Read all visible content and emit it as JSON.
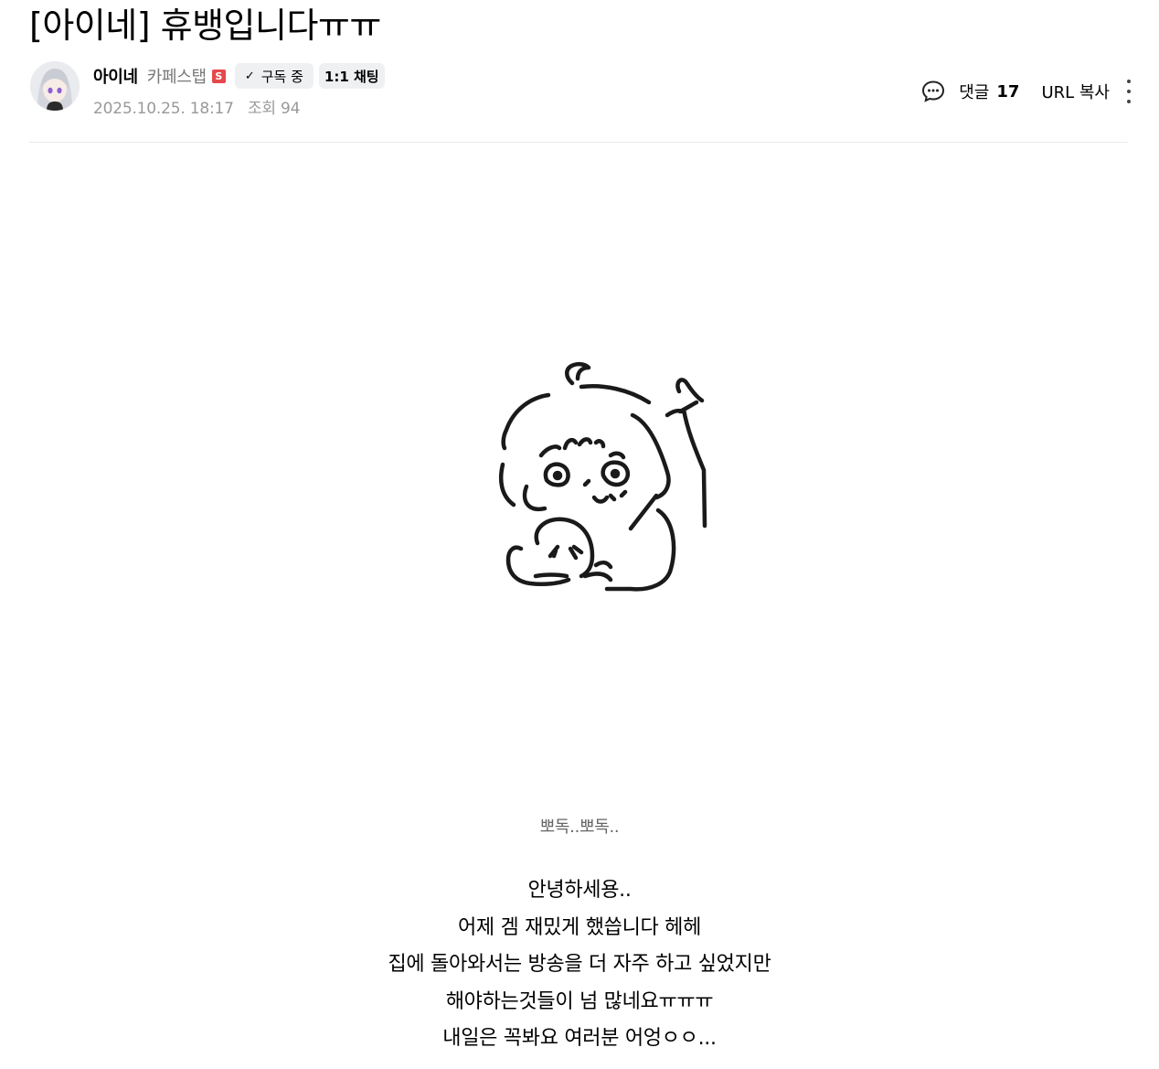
{
  "post": {
    "title": "[아이네] 휴뱅입니다ㅠㅠ"
  },
  "author": {
    "avatar_icon": "avatar-image",
    "name": "아이네",
    "level": "카페스탭",
    "staff_badge": "S",
    "subscribe_label": "구독 중",
    "chat_label": "1:1 채팅"
  },
  "meta": {
    "date": "2025.10.25. 18:17",
    "views": "조회 94"
  },
  "actions": {
    "comment_label": "댓글",
    "comment_count": "17",
    "url_copy_label": "URL 복사"
  },
  "content": {
    "caption": "뽀독..뽀독..",
    "lines": [
      "안녕하세용..",
      "어제 겜 재밌게 했씁니다 헤헤",
      "집에 돌아와서는 방송을 더 자주 하고 싶었지만",
      "해야하는것들이 넘 많네요ㅠㅠㅠ",
      "내일은 꼭봐요 여러분 어엉ㅇㅇ..."
    ]
  },
  "colors": {
    "staff_badge": "#e5484d",
    "button_bg": "#eff0f2",
    "meta_text": "#999999",
    "divider": "#ebebeb"
  }
}
